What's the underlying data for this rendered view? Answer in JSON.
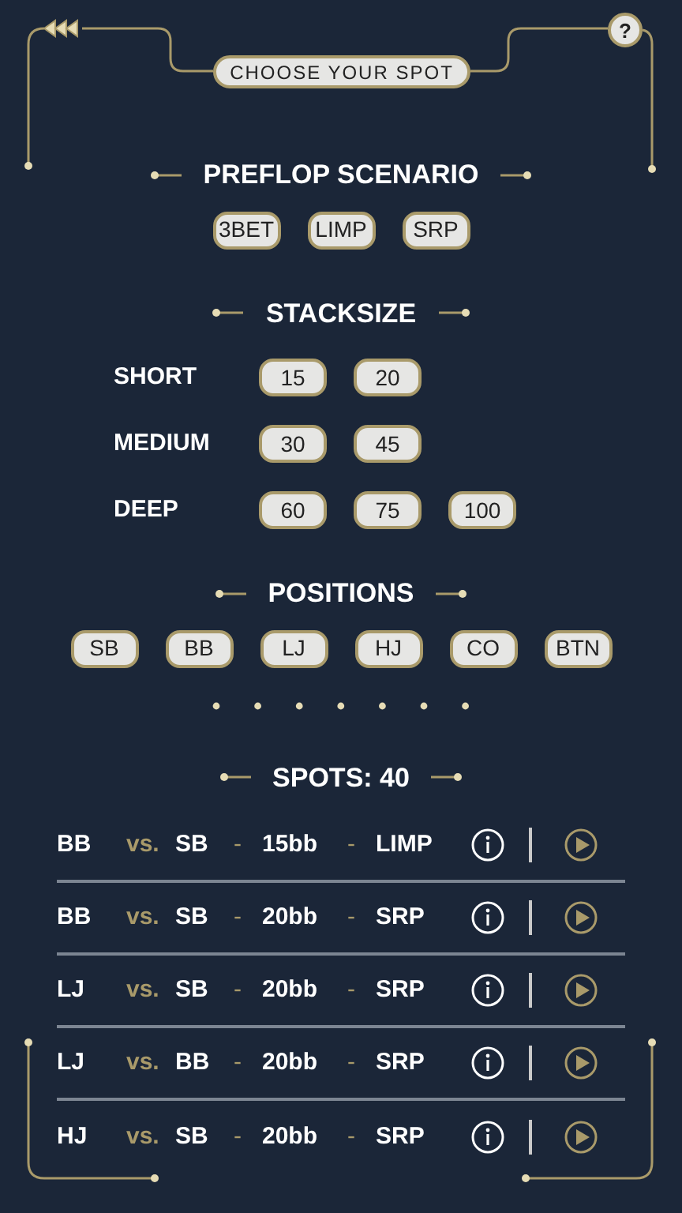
{
  "header": {
    "title": "CHOOSE YOUR SPOT",
    "help": "?"
  },
  "scenario": {
    "title": "PREFLOP SCENARIO",
    "options": [
      {
        "label": "3BET",
        "selected": false
      },
      {
        "label": "LIMP",
        "selected": false
      },
      {
        "label": "SRP",
        "selected": false
      }
    ]
  },
  "stacksize": {
    "title": "STACKSIZE",
    "groups": [
      {
        "label": "SHORT",
        "options": [
          {
            "label": "15",
            "selected": false
          },
          {
            "label": "20",
            "selected": false
          }
        ]
      },
      {
        "label": "MEDIUM",
        "options": [
          {
            "label": "30",
            "selected": false
          },
          {
            "label": "45",
            "selected": false
          }
        ]
      },
      {
        "label": "DEEP",
        "options": [
          {
            "label": "60",
            "selected": false
          },
          {
            "label": "75",
            "selected": false
          },
          {
            "label": "100",
            "selected": false
          }
        ]
      }
    ]
  },
  "positions": {
    "title": "POSITIONS",
    "options": [
      {
        "label": "SB",
        "selected": false
      },
      {
        "label": "BB",
        "selected": false
      },
      {
        "label": "LJ",
        "selected": false
      },
      {
        "label": "HJ",
        "selected": false
      },
      {
        "label": "CO",
        "selected": false
      },
      {
        "label": "BTN",
        "selected": false
      }
    ]
  },
  "spots": {
    "title": "SPOTS: 40",
    "rows": [
      {
        "hero": "BB",
        "vs": "vs.",
        "villain": "SB",
        "sep1": "-",
        "stack": "15bb",
        "sep2": "-",
        "scenario": "LIMP"
      },
      {
        "hero": "BB",
        "vs": "vs.",
        "villain": "SB",
        "sep1": "-",
        "stack": "20bb",
        "sep2": "-",
        "scenario": "SRP"
      },
      {
        "hero": "LJ",
        "vs": "vs.",
        "villain": "SB",
        "sep1": "-",
        "stack": "20bb",
        "sep2": "-",
        "scenario": "SRP"
      },
      {
        "hero": "LJ",
        "vs": "vs.",
        "villain": "BB",
        "sep1": "-",
        "stack": "20bb",
        "sep2": "-",
        "scenario": "SRP"
      },
      {
        "hero": "HJ",
        "vs": "vs.",
        "villain": "SB",
        "sep1": "-",
        "stack": "20bb",
        "sep2": "-",
        "scenario": "SRP"
      }
    ]
  }
}
